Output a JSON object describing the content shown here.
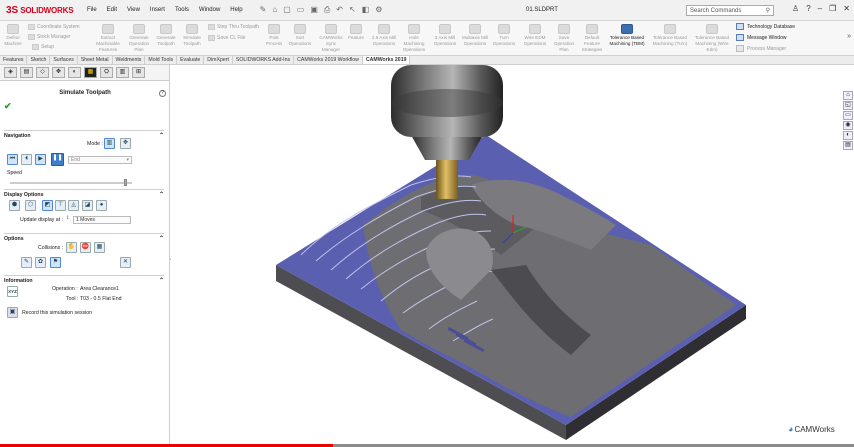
{
  "app": {
    "logo_mark": "3S",
    "logo_text": "SOLIDWORKS",
    "doc_title": "01.SLDPRT"
  },
  "menus": [
    "File",
    "Edit",
    "View",
    "Insert",
    "Tools",
    "Window",
    "Help"
  ],
  "search": {
    "placeholder": "Search Commands"
  },
  "ribbon": {
    "buttons": [
      "Define Machine",
      "Extract Machinable Features",
      "Generate Operation Plan",
      "Generate Toolpath",
      "Simulate Toolpath",
      "Post Process",
      "Sort Operations",
      "CAMWorks Sync Manager",
      "Feature",
      "2.5 Axis Mill Operations",
      "Hole Machining Operations",
      "3 Axis Mill Operations",
      "Multiaxis Mill Operations",
      "Turn Operations",
      "Wire EDM Operations",
      "Save Operation Plan",
      "Default Feature Strategies",
      "Tolerance Based Machining (TBM)",
      "Tolerance Based Machining (Turn)",
      "Tolerance Based Machining (Wire Edm)"
    ],
    "small": [
      "Coordinate System",
      "Stock Manager",
      "Setup",
      "Step Thru Toolpath",
      "Save CL File"
    ],
    "right": [
      "Technology Database",
      "Message Window",
      "Process Manager"
    ]
  },
  "tabs": [
    "Features",
    "Sketch",
    "Surfaces",
    "Sheet Metal",
    "Weldments",
    "Mold Tools",
    "Evaluate",
    "DimXpert",
    "SOLIDWORKS Add-Ins",
    "CAMWorks 2019 Workflow",
    "CAMWorks 2019"
  ],
  "panel": {
    "title": "Simulate Toolpath",
    "navigation": {
      "heading": "Navigation",
      "mode_label": "Mode :",
      "end_option": "End",
      "speed_label": "Speed",
      "speed_level": 0.95
    },
    "display": {
      "heading": "Display Options",
      "update_label": "Update display at :",
      "update_value": "1 Moves"
    },
    "options": {
      "heading": "Options",
      "collisions_label": "Collisions :"
    },
    "information": {
      "heading": "Information",
      "operation_label": "Operation :",
      "operation_value": "Area Clearance1",
      "tool_label": "Tool :",
      "tool_value": "T03 - 0.5 Flat End",
      "xyz": "XYZ",
      "record_label": "Record this simulation session"
    }
  },
  "brand": "CAMWorks",
  "playback_progress": 0.39,
  "colors": {
    "accent": "#3b6fb0",
    "stock": "#555e9a",
    "tool": "#c9a447"
  }
}
